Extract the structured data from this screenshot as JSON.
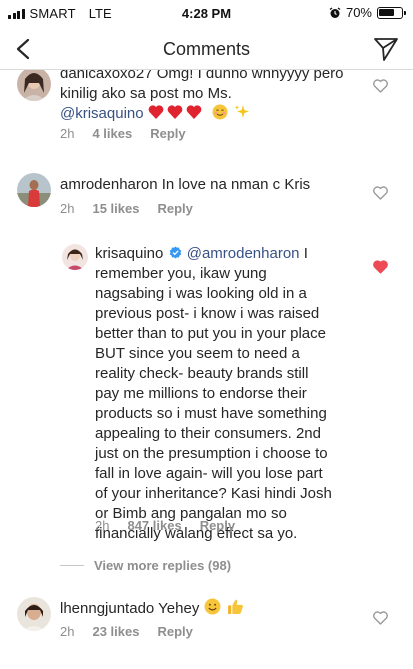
{
  "status_bar": {
    "carrier": "SMART",
    "network": "LTE",
    "time": "4:28 PM",
    "battery": "70%",
    "battery_level": 0.7
  },
  "header": {
    "title": "Comments"
  },
  "comments": [
    {
      "username": "danicaxoxo27",
      "text": "Omg! I dunno whhyyyy pero kinilig ako sa post mo Ms.",
      "mention": "@krisaquino",
      "time": "2h",
      "likes": "4 likes",
      "reply": "Reply",
      "liked": false
    },
    {
      "username": "amrodenharon",
      "text": "In love na nman c Kris",
      "time": "2h",
      "likes": "15 likes",
      "reply": "Reply",
      "liked": false
    },
    {
      "username": "krisaquino",
      "mention": "@amrodenharon",
      "text_lines": [
        "remember you, ikaw yung",
        "nagsabing i was looking old in a",
        "previous post- i know i was raised",
        "better than to put you in your place",
        "BUT since you seem to need a",
        "reality check- beauty brands still",
        "pay me millions to endorse their",
        "products so i must have something",
        "appealing to their consumers. 2nd",
        "just on the presumption i choose to",
        "fall in love again- will you lose part",
        "of your inheritance? Kasi hindi Josh",
        "or Bimb ang pangalan mo so",
        "financially walang effect sa yo."
      ],
      "first_line_tail": "I",
      "time": "2h",
      "likes": "847 likes",
      "reply": "Reply",
      "liked": true
    },
    {
      "username": "lhenngjuntado",
      "text": "Yehey",
      "time": "2h",
      "likes": "23 likes",
      "reply": "Reply",
      "liked": false
    }
  ],
  "view_more": "View more replies (98)",
  "colors": {
    "mention": "#385185",
    "like_red": "#ed4956",
    "meta_gray": "#8e8e8e"
  },
  "icons": [
    "back-arrow-icon",
    "send-icon",
    "heart-icon",
    "verified-badge-icon",
    "alarm-icon",
    "battery-icon",
    "signal-icon"
  ]
}
